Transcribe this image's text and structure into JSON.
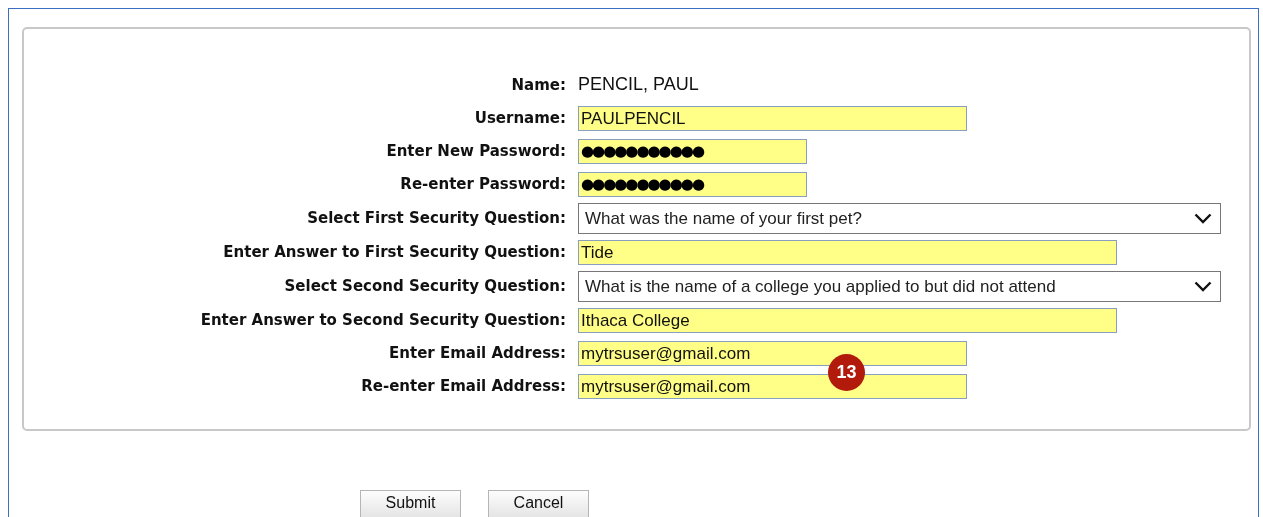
{
  "form": {
    "rows": [
      {
        "kind": "text",
        "label": "Name:",
        "value": "PENCIL, PAUL"
      },
      {
        "kind": "input",
        "label": "Username:",
        "value": "PAULPENCIL"
      },
      {
        "kind": "password",
        "label": "Enter New Password:",
        "value": "●●●●●●●●●●●"
      },
      {
        "kind": "password",
        "label": "Re-enter Password:",
        "value": "●●●●●●●●●●●"
      },
      {
        "kind": "select",
        "label": "Select First Security Question:",
        "value": "What was the name of your first pet?"
      },
      {
        "kind": "wide_input",
        "label": "Enter Answer to First Security Question:",
        "value": "Tide"
      },
      {
        "kind": "select",
        "label": "Select Second Security Question:",
        "value": "What is the name of a college you applied to but did not attend"
      },
      {
        "kind": "wide_input",
        "label": "Enter Answer to Second Security Question:",
        "value": "Ithaca College"
      },
      {
        "kind": "input",
        "label": "Enter Email Address:",
        "value": "mytrsuser@gmail.com"
      },
      {
        "kind": "input",
        "label": "Re-enter Email Address:",
        "value": "mytrsuser@gmail.com"
      }
    ]
  },
  "callout": "13",
  "buttons": [
    "Submit",
    "Cancel"
  ]
}
